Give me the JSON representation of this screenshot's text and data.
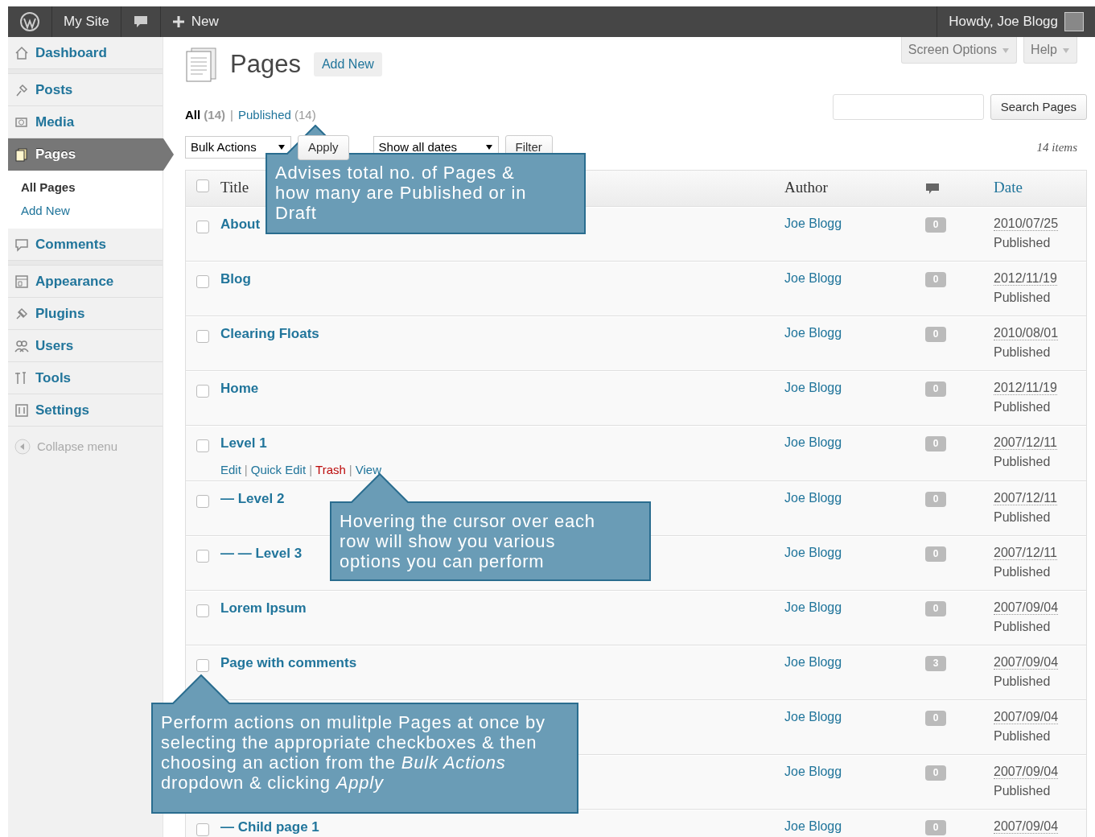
{
  "admin_bar": {
    "site": "My Site",
    "new": "New",
    "greeting": "Howdy, Joe Blogg"
  },
  "sidebar": {
    "items": [
      {
        "label": "Dashboard",
        "selected": false
      },
      {
        "label": "Posts",
        "selected": false
      },
      {
        "label": "Media",
        "selected": false
      },
      {
        "label": "Pages",
        "selected": true,
        "children": [
          {
            "label": "All Pages",
            "selected": true
          },
          {
            "label": "Add New",
            "selected": false
          }
        ]
      },
      {
        "label": "Comments",
        "selected": false
      },
      {
        "label": "Appearance",
        "selected": false
      },
      {
        "label": "Plugins",
        "selected": false
      },
      {
        "label": "Users",
        "selected": false
      },
      {
        "label": "Tools",
        "selected": false
      },
      {
        "label": "Settings",
        "selected": false
      }
    ],
    "collapse": "Collapse menu"
  },
  "screen_options": "Screen Options",
  "help": "Help",
  "heading": "Pages",
  "add_new": "Add New",
  "filter_separator": "|",
  "filters": [
    {
      "label": "All",
      "count": "(14)",
      "selected": true
    },
    {
      "label": "Published",
      "count": "(14)",
      "selected": false
    }
  ],
  "search": {
    "button": "Search Pages"
  },
  "bulk_actions": "Bulk Actions",
  "apply": "Apply",
  "dates": "Show all dates",
  "filter": "Filter",
  "item_count": "14 items",
  "table": {
    "columns": [
      "Title",
      "Author",
      "Date"
    ],
    "select_all_checked": false,
    "rows": [
      {
        "title": "About",
        "checked": false,
        "author": "Joe Blogg",
        "comments": "0",
        "date": "2010/07/25",
        "status": "Published"
      },
      {
        "title": "Blog",
        "checked": false,
        "author": "Joe Blogg",
        "comments": "0",
        "date": "2012/11/19",
        "status": "Published"
      },
      {
        "title": "Clearing Floats",
        "checked": false,
        "author": "Joe Blogg",
        "comments": "0",
        "date": "2010/08/01",
        "status": "Published"
      },
      {
        "title": "Home",
        "checked": false,
        "author": "Joe Blogg",
        "comments": "0",
        "date": "2012/11/19",
        "status": "Published"
      },
      {
        "title": "Level 1",
        "checked": false,
        "author": "Joe Blogg",
        "comments": "0",
        "date": "2007/12/11",
        "status": "Published",
        "actions_separator": "|",
        "actions": [
          {
            "label": "Edit",
            "kind": "link"
          },
          {
            "label": "Quick Edit",
            "kind": "link"
          },
          {
            "label": "Trash",
            "kind": "danger"
          },
          {
            "label": "View",
            "kind": "link"
          }
        ]
      },
      {
        "title": "— Level 2",
        "checked": false,
        "author": "Joe Blogg",
        "comments": "0",
        "date": "2007/12/11",
        "status": "Published"
      },
      {
        "title": "— — Level 3",
        "checked": false,
        "author": "Joe Blogg",
        "comments": "0",
        "date": "2007/12/11",
        "status": "Published"
      },
      {
        "title": "Lorem Ipsum",
        "checked": false,
        "author": "Joe Blogg",
        "comments": "0",
        "date": "2007/09/04",
        "status": "Published"
      },
      {
        "title": "Page with comments",
        "checked": false,
        "author": "Joe Blogg",
        "comments": "3",
        "date": "2007/09/04",
        "status": "Published"
      },
      {
        "author": "Joe Blogg",
        "comments": "0",
        "date": "2007/09/04",
        "status": "Published"
      },
      {
        "author": "Joe Blogg",
        "comments": "0",
        "date": "2007/09/04",
        "status": "Published"
      },
      {
        "title": "— Child page 1",
        "checked": false,
        "author": "Joe Blogg",
        "comments": "0",
        "date": "2007/09/04"
      }
    ]
  },
  "callouts": [
    {
      "text": "Advises total no. of Pages & how many are Published or in Draft"
    },
    {
      "text": "Hovering the cursor over each row will show you various options you can perform"
    },
    {
      "text": "Perform actions on mulitple Pages at once by selecting the appropriate checkboxes & then choosing an action from the *Bulk Actions* dropdown & clicking *Apply*"
    }
  ]
}
